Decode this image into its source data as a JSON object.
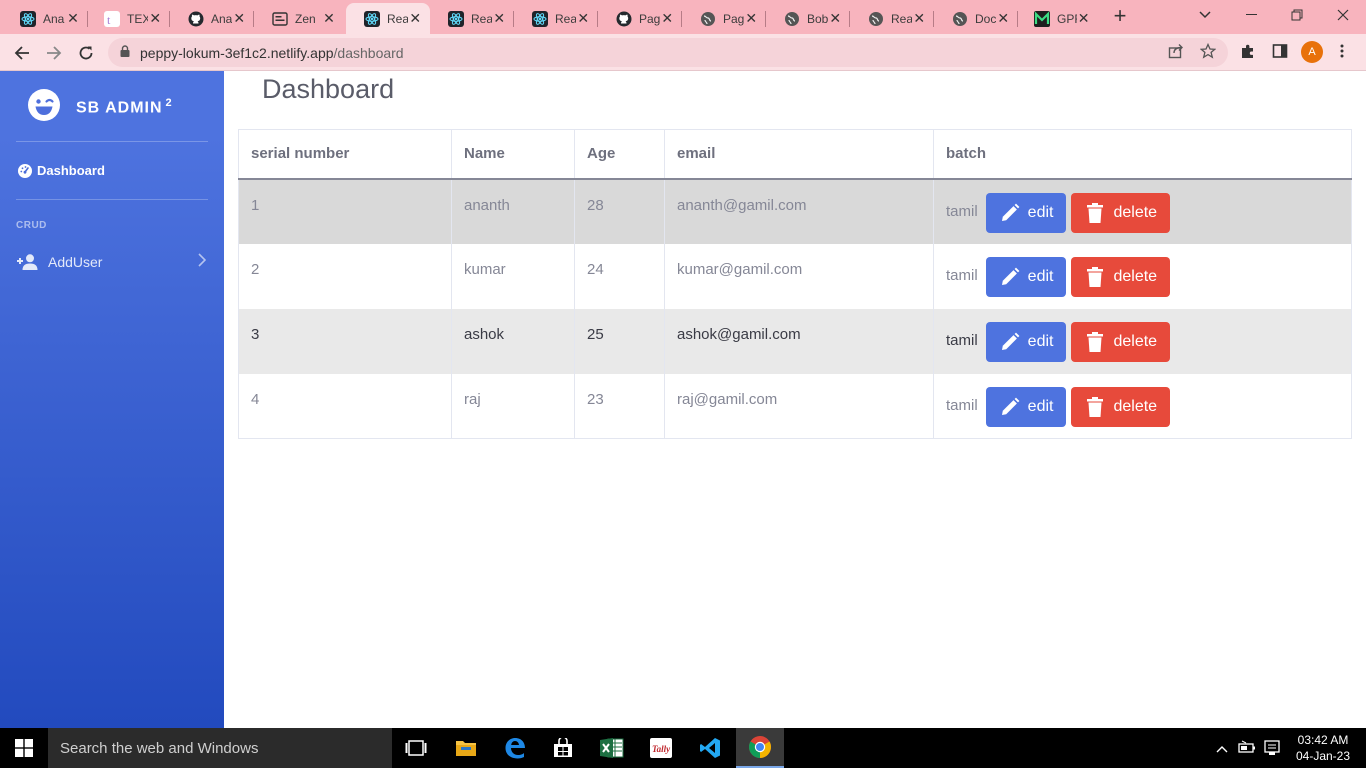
{
  "browser": {
    "tabs": [
      {
        "title": "Ana",
        "icon": "react-icon"
      },
      {
        "title": "TEX",
        "icon": "tex-icon"
      },
      {
        "title": "Ana",
        "icon": "github-icon"
      },
      {
        "title": "Zen",
        "icon": "zen-icon"
      },
      {
        "title": "Rea",
        "icon": "react-icon",
        "active": true
      },
      {
        "title": "Rea",
        "icon": "react-icon"
      },
      {
        "title": "Rea",
        "icon": "react-icon"
      },
      {
        "title": "Pag",
        "icon": "github-icon"
      },
      {
        "title": "Pag",
        "icon": "globe-icon"
      },
      {
        "title": "Bob",
        "icon": "globe-icon"
      },
      {
        "title": "Rea",
        "icon": "globe-icon"
      },
      {
        "title": "Doc",
        "icon": "globe-icon"
      },
      {
        "title": "GPF",
        "icon": "gpf-icon"
      }
    ],
    "close_glyph": "✕",
    "url_host": "peppy-lokum-3ef1c2.netlify.app",
    "url_path": "/dashboard",
    "profile_initial": "A"
  },
  "sidebar": {
    "brand": "SB ADMIN",
    "brand_sup": "2",
    "dashboard_label": "Dashboard",
    "heading": "CRUD",
    "adduser_label": "AddUser"
  },
  "main": {
    "title": "Dashboard",
    "columns": [
      "serial number",
      "Name",
      "Age",
      "email",
      "batch"
    ],
    "rows": [
      {
        "serial": "1",
        "name": "ananth",
        "age": "28",
        "email": "ananth@gamil.com",
        "batch": "tamil"
      },
      {
        "serial": "2",
        "name": "kumar",
        "age": "24",
        "email": "kumar@gamil.com",
        "batch": "tamil"
      },
      {
        "serial": "3",
        "name": "ashok",
        "age": "25",
        "email": "ashok@gamil.com",
        "batch": "tamil"
      },
      {
        "serial": "4",
        "name": "raj",
        "age": "23",
        "email": "raj@gamil.com",
        "batch": "tamil"
      }
    ],
    "edit_label": "edit",
    "delete_label": "delete"
  },
  "taskbar": {
    "search_placeholder": "Search the web and Windows",
    "time": "03:42 AM",
    "date": "04-Jan-23"
  },
  "colors": {
    "primary": "#4e73df",
    "danger": "#e74a3b",
    "tab_strip": "#f8b4be"
  }
}
